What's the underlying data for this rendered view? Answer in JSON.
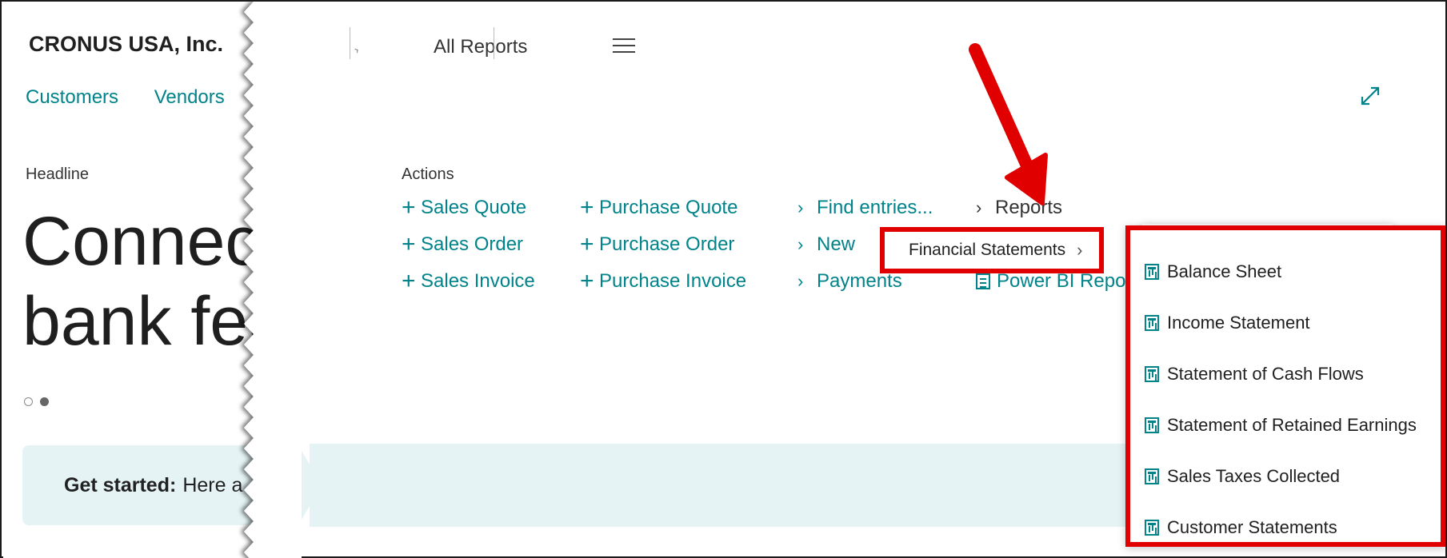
{
  "company": "CRONUS USA, Inc.",
  "nav": [
    "Customers",
    "Vendors"
  ],
  "headline": {
    "label": "Headline",
    "line1": "Connect",
    "line2": "bank feed"
  },
  "get_started": {
    "bold": "Get started:",
    "text": "Here a"
  },
  "top_bar": {
    "all_reports": "All Reports"
  },
  "actions": {
    "label": "Actions",
    "col1": [
      "Sales Quote",
      "Sales Order",
      "Sales Invoice"
    ],
    "col2": [
      "Purchase Quote",
      "Purchase Order",
      "Purchase Invoice"
    ],
    "col3": [
      "Find entries...",
      "New",
      "Payments"
    ],
    "reports": "Reports",
    "power_bi": "Power BI Repo"
  },
  "submenu": {
    "financial_statements": "Financial Statements"
  },
  "financial_reports": [
    "Balance Sheet",
    "Income Statement",
    "Statement of Cash Flows",
    "Statement of Retained Earnings",
    "Sales Taxes Collected",
    "Customer Statements"
  ],
  "colors": {
    "accent": "#00838a",
    "highlight": "#e00000",
    "band": "#e5f3f4"
  },
  "icons": [
    "expand-icon",
    "hamburger-icon",
    "report-icon",
    "plus-icon",
    "chevron-right-icon"
  ]
}
